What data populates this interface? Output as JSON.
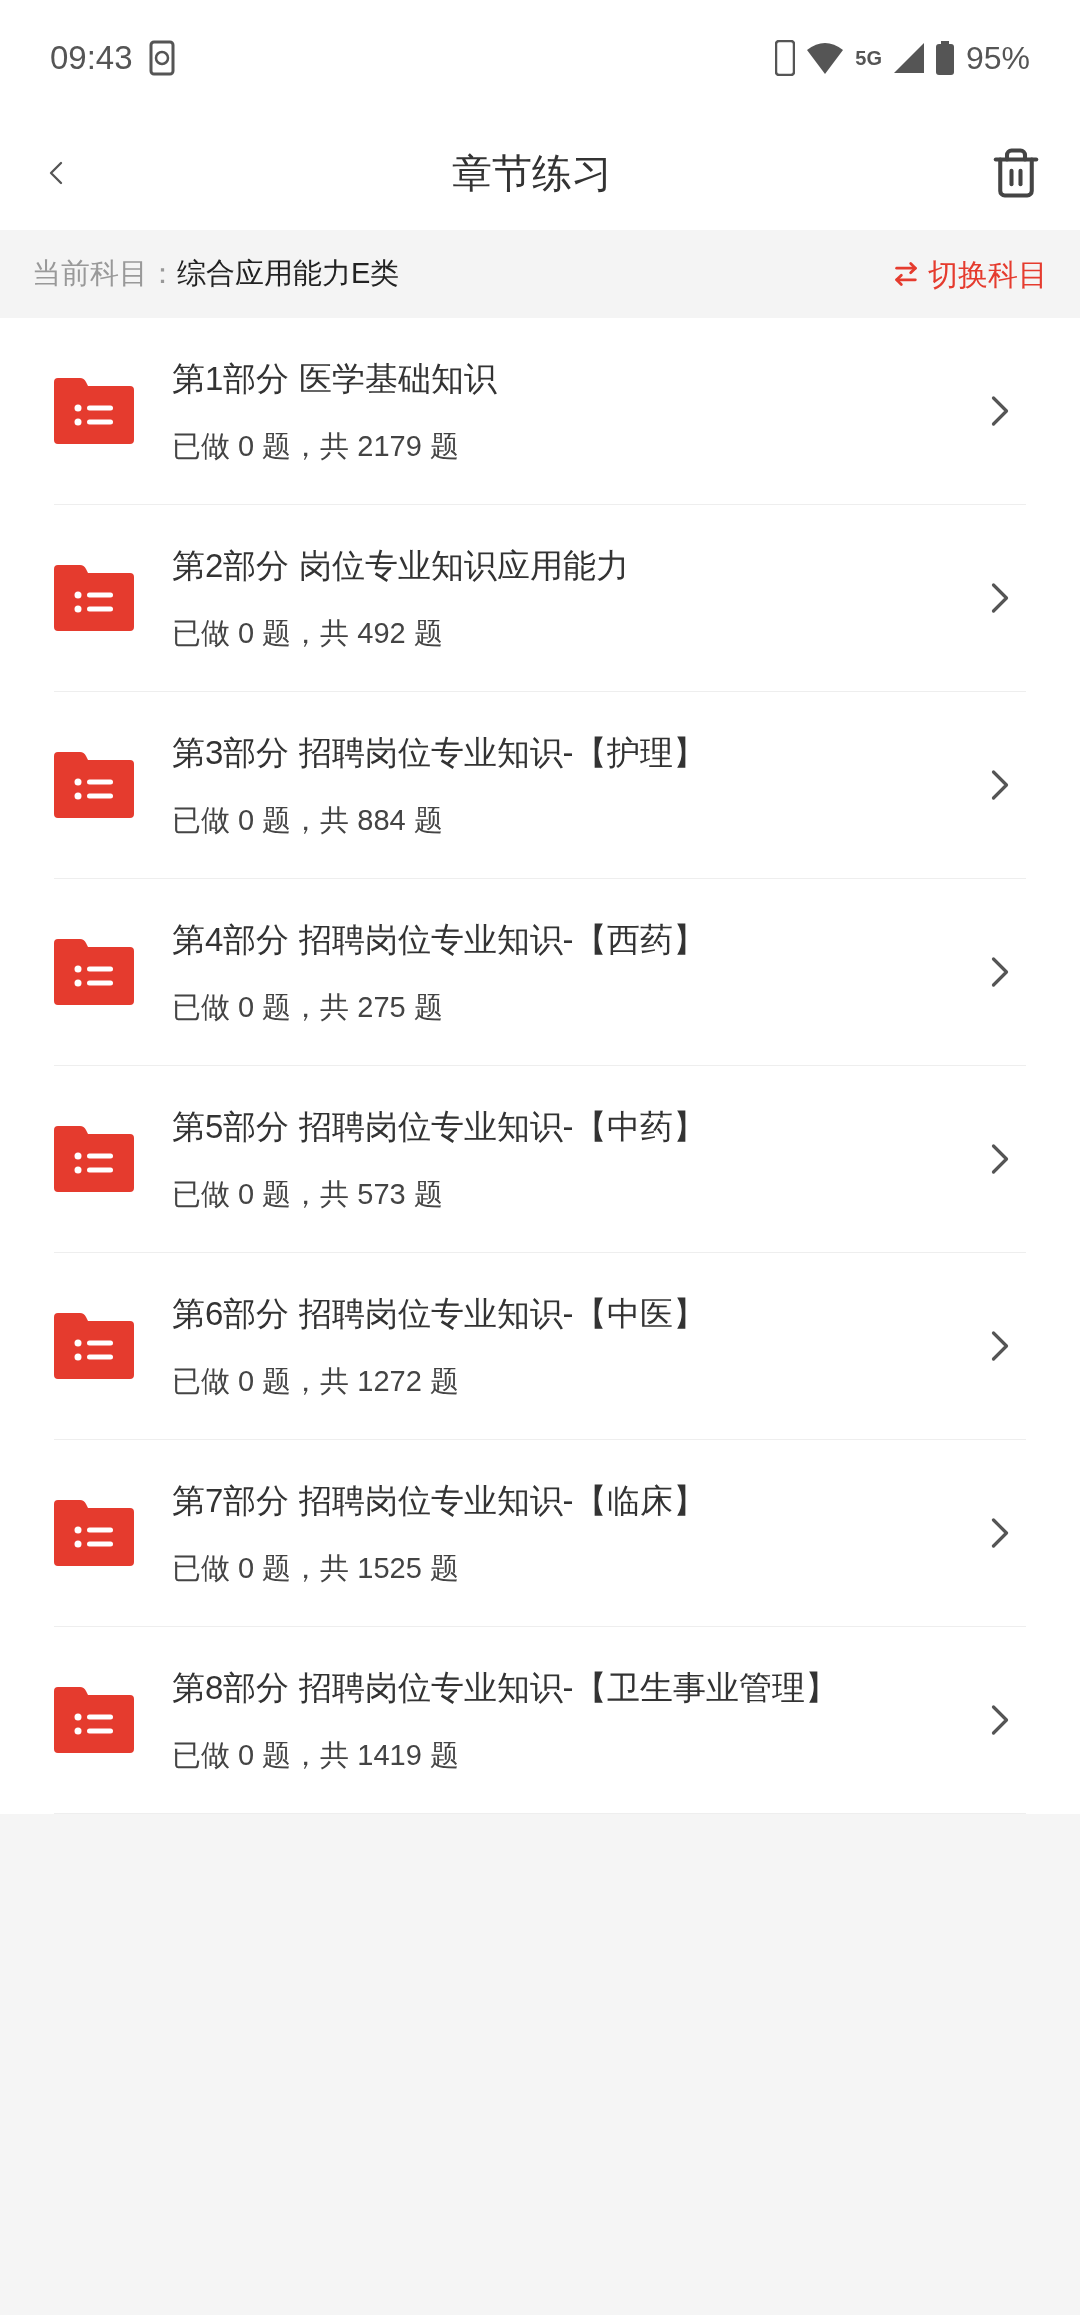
{
  "status_bar": {
    "time": "09:43",
    "battery": "95%",
    "network": "5G"
  },
  "header": {
    "title": "章节练习"
  },
  "subject_bar": {
    "label": "当前科目：",
    "value": "综合应用能力E类",
    "switch_label": "切换科目"
  },
  "chapters": [
    {
      "title": "第1部分 医学基础知识",
      "progress": "已做 0 题，共 2179 题"
    },
    {
      "title": "第2部分 岗位专业知识应用能力",
      "progress": "已做 0 题，共 492 题"
    },
    {
      "title": "第3部分 招聘岗位专业知识-【护理】",
      "progress": "已做 0 题，共 884 题"
    },
    {
      "title": "第4部分 招聘岗位专业知识-【西药】",
      "progress": "已做 0 题，共 275 题"
    },
    {
      "title": "第5部分 招聘岗位专业知识-【中药】",
      "progress": "已做 0 题，共 573 题"
    },
    {
      "title": "第6部分 招聘岗位专业知识-【中医】",
      "progress": "已做 0 题，共 1272 题"
    },
    {
      "title": "第7部分 招聘岗位专业知识-【临床】",
      "progress": "已做 0 题，共 1525 题"
    },
    {
      "title": "第8部分 招聘岗位专业知识-【卫生事业管理】",
      "progress": "已做 0 题，共 1419 题"
    }
  ]
}
